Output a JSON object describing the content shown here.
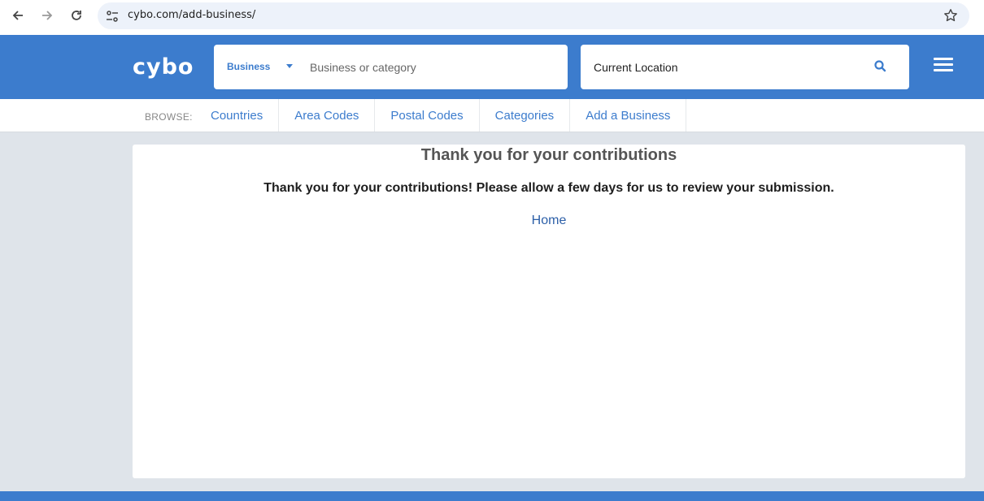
{
  "browser": {
    "url": "cybo.com/add-business/"
  },
  "header": {
    "logo_text": "cybo",
    "search_type": "Business",
    "search_placeholder": "Business or category",
    "location_value": "Current Location"
  },
  "browse": {
    "label": "BROWSE:",
    "links": [
      "Countries",
      "Area Codes",
      "Postal Codes",
      "Categories",
      "Add a Business"
    ]
  },
  "content": {
    "title": "Thank you for your contributions",
    "message": "Thank you for your contributions! Please allow a few days for us to review your submission.",
    "home_link": "Home"
  },
  "colors": {
    "brand_blue": "#3c7ccd",
    "page_bg": "#dfe4ea"
  }
}
